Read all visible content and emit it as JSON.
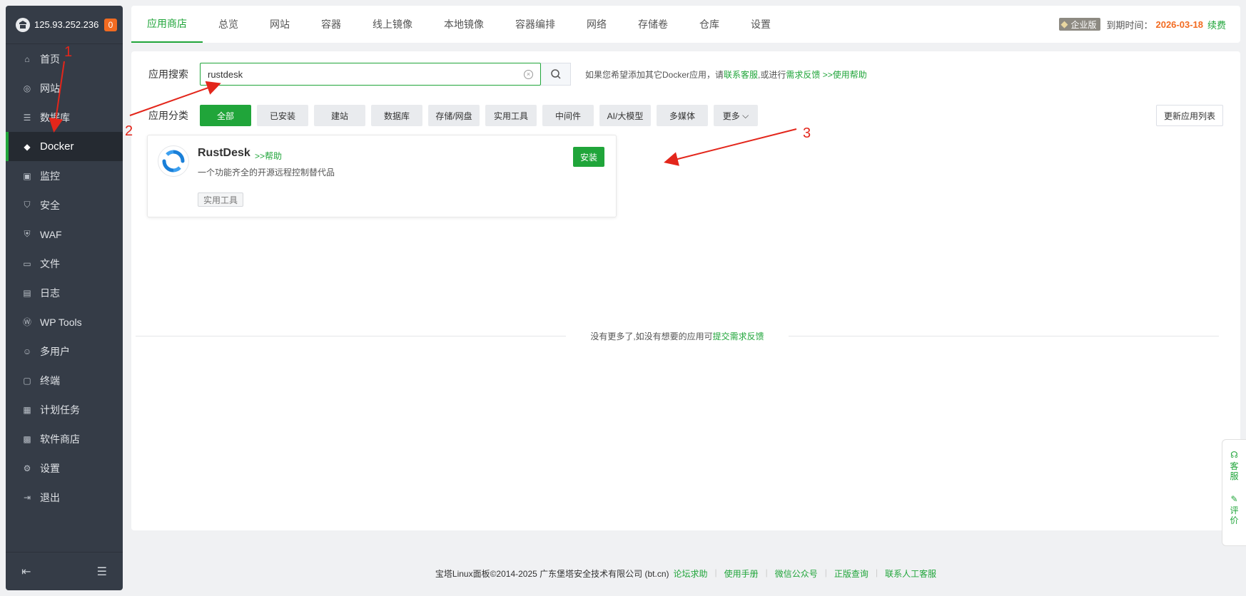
{
  "sidebar": {
    "ip": "125.93.252.236",
    "badge": "0",
    "items": [
      {
        "label": "首页",
        "icon": "home-icon"
      },
      {
        "label": "网站",
        "icon": "globe-icon"
      },
      {
        "label": "数据库",
        "icon": "database-icon"
      },
      {
        "label": "Docker",
        "icon": "docker-icon",
        "active": true
      },
      {
        "label": "监控",
        "icon": "monitor-icon"
      },
      {
        "label": "安全",
        "icon": "shield-icon"
      },
      {
        "label": "WAF",
        "icon": "waf-icon"
      },
      {
        "label": "文件",
        "icon": "folder-icon"
      },
      {
        "label": "日志",
        "icon": "log-icon"
      },
      {
        "label": "WP Tools",
        "icon": "wordpress-icon"
      },
      {
        "label": "多用户",
        "icon": "users-icon"
      },
      {
        "label": "终端",
        "icon": "terminal-icon"
      },
      {
        "label": "计划任务",
        "icon": "calendar-icon"
      },
      {
        "label": "软件商店",
        "icon": "store-icon"
      },
      {
        "label": "设置",
        "icon": "gear-icon"
      },
      {
        "label": "退出",
        "icon": "logout-icon"
      }
    ]
  },
  "topbar": {
    "tabs": [
      "应用商店",
      "总览",
      "网站",
      "容器",
      "线上镜像",
      "本地镜像",
      "容器编排",
      "网络",
      "存储卷",
      "仓库",
      "设置"
    ],
    "edition": "企业版",
    "expire_label": "到期时间：",
    "expire_date": "2026-03-18",
    "renew": "续费"
  },
  "search": {
    "label": "应用搜索",
    "value": "rustdesk",
    "hint_prefix": "如果您希望添加其它Docker应用，请",
    "hint_link1": "联系客服",
    "hint_mid": ",或进行",
    "hint_link2": "需求反馈",
    "hint_link3": " >>使用帮助"
  },
  "categories": {
    "label": "应用分类",
    "items": [
      "全部",
      "已安装",
      "建站",
      "数据库",
      "存储/网盘",
      "实用工具",
      "中间件",
      "AI/大模型",
      "多媒体"
    ],
    "more": "更多",
    "refresh": "更新应用列表"
  },
  "app": {
    "name": "RustDesk",
    "help": ">>帮助",
    "desc": "一个功能齐全的开源远程控制替代品",
    "tag": "实用工具",
    "install": "安装"
  },
  "nomore": {
    "text": "没有更多了,如没有想要的应用可",
    "link": "提交需求反馈"
  },
  "float": {
    "service": "客服",
    "review": "评价"
  },
  "footer": {
    "copyright": "宝塔Linux面板©2014-2025 广东堡塔安全技术有限公司 (bt.cn)",
    "links": [
      "论坛求助",
      "使用手册",
      "微信公众号",
      "正版查询",
      "联系人工客服"
    ]
  },
  "annotations": [
    "1",
    "2",
    "3"
  ],
  "colors": {
    "accent": "#20a53a",
    "sidebar": "#353c47",
    "annotation": "#e3261b",
    "badge": "#f26b21"
  }
}
